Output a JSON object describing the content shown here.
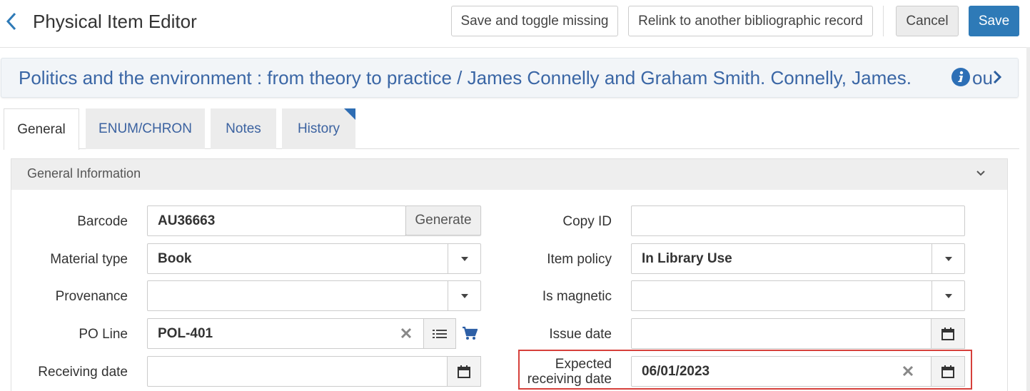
{
  "header": {
    "title": "Physical Item Editor",
    "buttons": {
      "save_toggle_missing": "Save and toggle missing",
      "relink": "Relink to another bibliographic record",
      "cancel": "Cancel",
      "save": "Save"
    }
  },
  "bib": {
    "text": "Politics and the environment : from theory to practice / James Connelly and Graham Smith. Connelly, James.",
    "tail": "ou"
  },
  "tabs": [
    "General",
    "ENUM/CHRON",
    "Notes",
    "History"
  ],
  "section": {
    "title": "General Information"
  },
  "form": {
    "barcode": {
      "label": "Barcode",
      "value": "AU36663",
      "button": "Generate"
    },
    "material_type": {
      "label": "Material type",
      "value": "Book"
    },
    "provenance": {
      "label": "Provenance",
      "value": ""
    },
    "po_line": {
      "label": "PO Line",
      "value": "POL-401"
    },
    "receiving_date": {
      "label": "Receiving date",
      "value": ""
    },
    "copy_id": {
      "label": "Copy ID",
      "value": ""
    },
    "item_policy": {
      "label": "Item policy",
      "value": "In Library Use"
    },
    "is_magnetic": {
      "label": "Is magnetic",
      "value": ""
    },
    "issue_date": {
      "label": "Issue date",
      "value": ""
    },
    "expected_receiving_date": {
      "label_line1": "Expected",
      "label_line2": "receiving date",
      "value": "06/01/2023"
    }
  },
  "colors": {
    "primary": "#2e7ab7",
    "link": "#3a66a5",
    "highlight": "#d6403b"
  },
  "icons": [
    "back-chevron-icon",
    "info-icon",
    "chevron-right-icon",
    "chevron-down-icon",
    "caret-down-icon",
    "clear-icon",
    "list-icon",
    "cart-icon",
    "calendar-icon"
  ]
}
